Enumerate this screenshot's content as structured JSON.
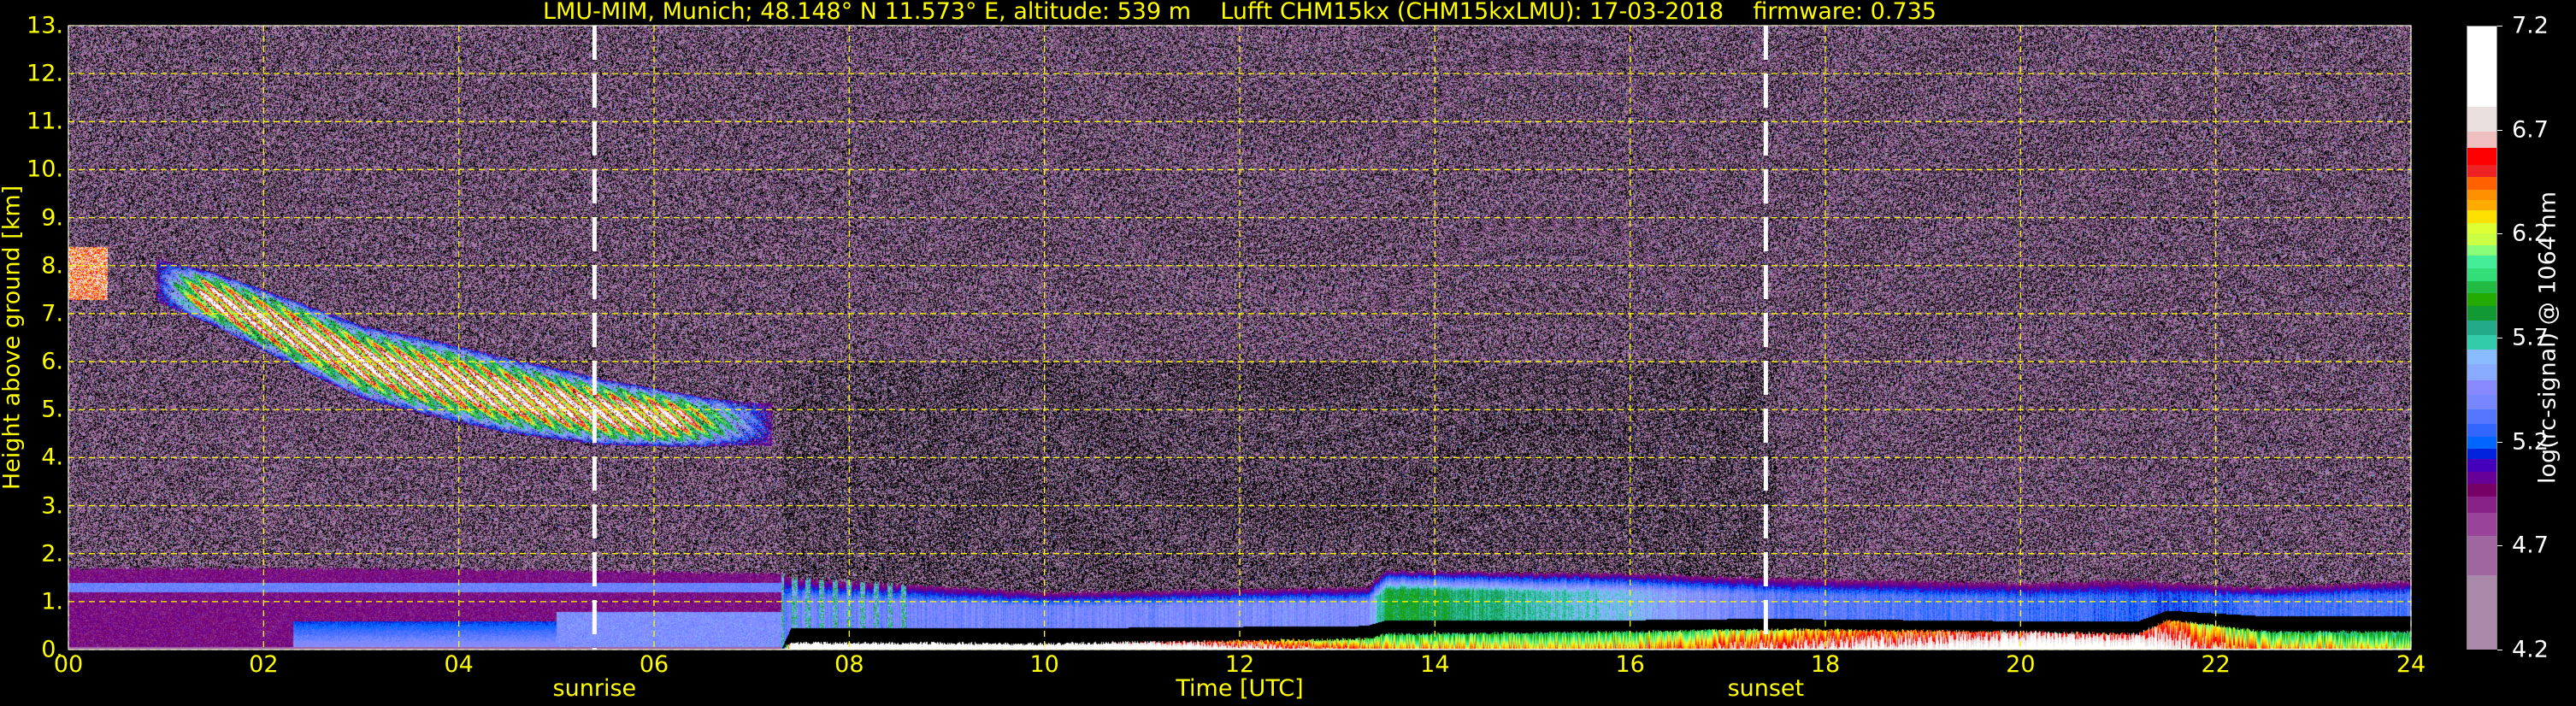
{
  "title": "LMU-MIM, Munich; 48.148° N 11.573° E, altitude: 539 m    Lufft CHM15kx (CHM15kxLMU): 17-03-2018    firmware: 0.735",
  "chart_data": {
    "type": "heatmap",
    "xlabel": "Time [UTC]",
    "ylabel": "Height above ground [km]",
    "xlim": [
      0,
      24
    ],
    "ylim": [
      0,
      13
    ],
    "grid": true,
    "x_ticks": [
      "00",
      "02",
      "04",
      "06",
      "08",
      "10",
      "12",
      "14",
      "16",
      "18",
      "20",
      "22",
      "24"
    ],
    "x_tick_values": [
      0,
      2,
      4,
      6,
      8,
      10,
      12,
      14,
      16,
      18,
      20,
      22,
      24
    ],
    "y_ticks": [
      "0.",
      "1.",
      "2.",
      "3.",
      "4.",
      "5.",
      "6.",
      "7.",
      "8.",
      "9.",
      "10.",
      "11.",
      "12.",
      "13."
    ],
    "y_tick_values": [
      0,
      1,
      2,
      3,
      4,
      5,
      6,
      7,
      8,
      9,
      10,
      11,
      12,
      13
    ],
    "markers": [
      {
        "label": "sunrise",
        "time": 5.39
      },
      {
        "label": "sunset",
        "time": 17.39
      }
    ],
    "colorbar": {
      "label": "log(rc-signal) @ 1064 nm",
      "range": [
        4.2,
        7.2
      ],
      "ticks": [
        "4.2",
        "4.7",
        "5.2",
        "5.7",
        "6.2",
        "6.7",
        "7.2"
      ],
      "tick_values": [
        4.2,
        4.7,
        5.2,
        5.7,
        6.2,
        6.7,
        7.2
      ],
      "levels": [
        {
          "from": 4.2,
          "color": "#aa88aa"
        },
        {
          "from": 4.56,
          "color": "#a066a0"
        },
        {
          "from": 4.75,
          "color": "#994499"
        },
        {
          "from": 4.86,
          "color": "#882288"
        },
        {
          "from": 4.94,
          "color": "#770066"
        },
        {
          "from": 5.0,
          "color": "#660099"
        },
        {
          "from": 5.06,
          "color": "#4400bb"
        },
        {
          "from": 5.12,
          "color": "#0022dd"
        },
        {
          "from": 5.17,
          "color": "#0066ff"
        },
        {
          "from": 5.23,
          "color": "#3366ff"
        },
        {
          "from": 5.29,
          "color": "#5577ff"
        },
        {
          "from": 5.36,
          "color": "#7788ff"
        },
        {
          "from": 5.43,
          "color": "#8888ff"
        },
        {
          "from": 5.5,
          "color": "#88aaff"
        },
        {
          "from": 5.58,
          "color": "#88bbff"
        },
        {
          "from": 5.65,
          "color": "#33ccaa"
        },
        {
          "from": 5.72,
          "color": "#22aa88"
        },
        {
          "from": 5.79,
          "color": "#119933"
        },
        {
          "from": 5.86,
          "color": "#22aa00"
        },
        {
          "from": 5.92,
          "color": "#22bb44"
        },
        {
          "from": 5.98,
          "color": "#33dd77"
        },
        {
          "from": 6.04,
          "color": "#44ee99"
        },
        {
          "from": 6.1,
          "color": "#88ff77"
        },
        {
          "from": 6.15,
          "color": "#ccff44"
        },
        {
          "from": 6.21,
          "color": "#ddff33"
        },
        {
          "from": 6.26,
          "color": "#ffe000"
        },
        {
          "from": 6.32,
          "color": "#ffaa00"
        },
        {
          "from": 6.37,
          "color": "#ff9000"
        },
        {
          "from": 6.42,
          "color": "#ff6000"
        },
        {
          "from": 6.48,
          "color": "#ee2222"
        },
        {
          "from": 6.54,
          "color": "#ff0000"
        },
        {
          "from": 6.62,
          "color": "#f0c0c0"
        },
        {
          "from": 6.7,
          "color": "#ebe0e0"
        },
        {
          "from": 6.82,
          "color": "#ffffff"
        }
      ],
      "below_range_color": "#000000"
    },
    "cirrus_track": {
      "time": [
        0.9,
        1.5,
        3.0,
        4.5,
        5.5,
        6.5,
        7.2
      ],
      "height": [
        7.7,
        7.3,
        6.0,
        5.3,
        4.95,
        4.75,
        4.7
      ],
      "max_value": 7.0
    },
    "boundary_layer": {
      "time": [
        0,
        3,
        7.3,
        7.4,
        10,
        13.3,
        13.5,
        16,
        17.4,
        20,
        21.2,
        21.5,
        22.5,
        24
      ],
      "aerosol_top": [
        1.7,
        1.7,
        1.6,
        1.5,
        1.2,
        1.3,
        1.65,
        1.6,
        1.5,
        1.4,
        1.45,
        1.4,
        1.3,
        1.45
      ],
      "aerosol_base": [
        0.0,
        0.0,
        0.0,
        0.45,
        0.45,
        0.5,
        0.62,
        0.62,
        0.65,
        0.6,
        0.6,
        0.82,
        0.7,
        0.7
      ],
      "aerosol_value": [
        5.1,
        5.2,
        5.3,
        5.4,
        5.4,
        5.45,
        5.85,
        5.6,
        5.35,
        5.3,
        5.25,
        5.2,
        5.3,
        5.3
      ],
      "surface_top": [
        0.0,
        0.0,
        0.0,
        0.12,
        0.1,
        0.2,
        0.3,
        0.35,
        0.4,
        0.35,
        0.3,
        0.6,
        0.35,
        0.35
      ],
      "surface_value": [
        4.2,
        4.2,
        4.2,
        7.0,
        7.0,
        6.0,
        5.9,
        5.9,
        6.2,
        6.6,
        6.6,
        6.4,
        5.9,
        5.8
      ]
    }
  }
}
